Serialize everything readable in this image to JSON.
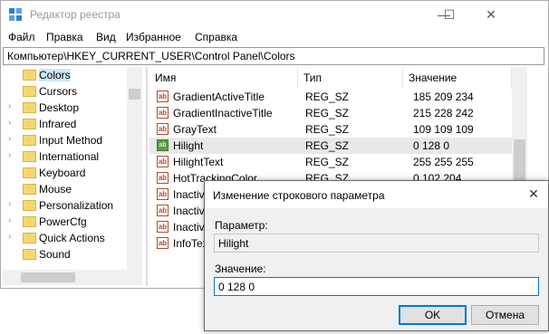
{
  "window": {
    "title": "Редактор реестра",
    "minimize": "—",
    "maximize": "☐",
    "close": "✕"
  },
  "menu": [
    "Файл",
    "Правка",
    "Вид",
    "Избранное",
    "Справка"
  ],
  "address": "Компьютер\\HKEY_CURRENT_USER\\Control Panel\\Colors",
  "tree": [
    {
      "label": "Colors",
      "arrow": "",
      "selected": true
    },
    {
      "label": "Cursors",
      "arrow": ""
    },
    {
      "label": "Desktop",
      "arrow": "›"
    },
    {
      "label": "Infrared",
      "arrow": "›"
    },
    {
      "label": "Input Method",
      "arrow": "›"
    },
    {
      "label": "International",
      "arrow": "›"
    },
    {
      "label": "Keyboard",
      "arrow": ""
    },
    {
      "label": "Mouse",
      "arrow": ""
    },
    {
      "label": "Personalization",
      "arrow": "›"
    },
    {
      "label": "PowerCfg",
      "arrow": "›"
    },
    {
      "label": "Quick Actions",
      "arrow": "›"
    },
    {
      "label": "Sound",
      "arrow": ""
    }
  ],
  "columns": [
    "Имя",
    "Тип",
    "Значение"
  ],
  "rows": [
    {
      "name": "GradientActiveTitle",
      "type": "REG_SZ",
      "value": "185 209 234",
      "icon": "ab"
    },
    {
      "name": "GradientInactiveTitle",
      "type": "REG_SZ",
      "value": "215 228 242",
      "icon": "ab"
    },
    {
      "name": "GrayText",
      "type": "REG_SZ",
      "value": "109 109 109",
      "icon": "ab"
    },
    {
      "name": "Hilight",
      "type": "REG_SZ",
      "value": "0 128 0",
      "icon": "bin",
      "selected": true
    },
    {
      "name": "HilightText",
      "type": "REG_SZ",
      "value": "255 255 255",
      "icon": "ab"
    },
    {
      "name": "HotTrackingColor",
      "type": "REG_SZ",
      "value": "0 102 204",
      "icon": "ab"
    },
    {
      "name": "InactiveBorder",
      "type": "",
      "value": "",
      "icon": "ab"
    },
    {
      "name": "InactiveTitle",
      "type": "",
      "value": "",
      "icon": "ab"
    },
    {
      "name": "InactiveTitleText",
      "type": "",
      "value": "",
      "icon": "ab"
    },
    {
      "name": "InfoText",
      "type": "",
      "value": "",
      "icon": "ab"
    }
  ],
  "dialog": {
    "title": "Изменение строкового параметра",
    "close": "✕",
    "param_label": "Параметр:",
    "param_value": "Hilight",
    "value_label": "Значение:",
    "value_value": "0 128 0",
    "ok": "OK",
    "cancel": "Отмена"
  },
  "icon_glyphs": {
    "ab": "ab",
    "bin": "ab"
  }
}
